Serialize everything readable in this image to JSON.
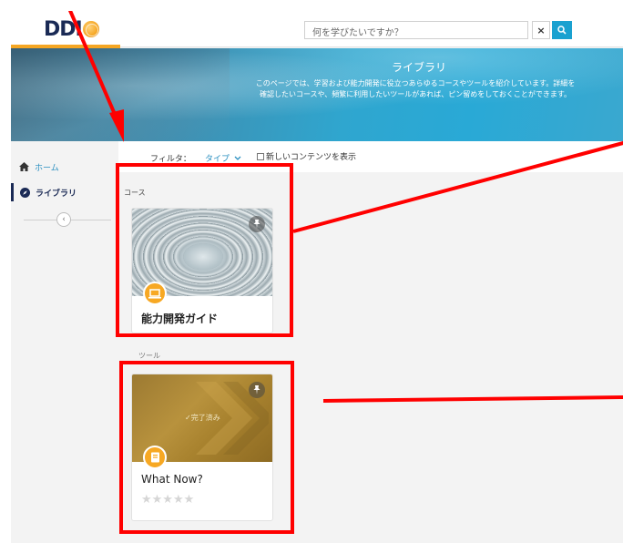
{
  "header": {
    "logo_text": "DDI",
    "search_placeholder": "何を学びたいですか？",
    "clear_label": "×"
  },
  "banner": {
    "title": "ライブラリ",
    "description": "このページでは、学習および能力開発に役立つあらゆるコースやツールを紹介しています。詳細を確認したいコースや、頻繁に利用したいツールがあれば、ピン留めをしておくことができます。"
  },
  "sidebar": {
    "items": [
      {
        "label": "ホーム",
        "icon": "home-icon"
      },
      {
        "label": "ライブラリ",
        "icon": "compass-icon"
      }
    ],
    "collapse_glyph": "‹"
  },
  "filter": {
    "label": "フィルタ：",
    "type_label": "タイプ",
    "new_content_label": "新しいコンテンツを表示"
  },
  "sections": [
    {
      "label": "コース",
      "card": {
        "title": "能力開発ガイド",
        "badge_icon": "laptop-icon"
      }
    },
    {
      "label": "ツール",
      "card": {
        "title": "What Now?",
        "status": "✓完了済み",
        "badge_icon": "book-icon",
        "rating_stars": "★★★★★"
      }
    }
  ],
  "colors": {
    "accent": "#1aa1d0",
    "brand_orange": "#f5a623",
    "annotation_red": "#ff0000"
  }
}
